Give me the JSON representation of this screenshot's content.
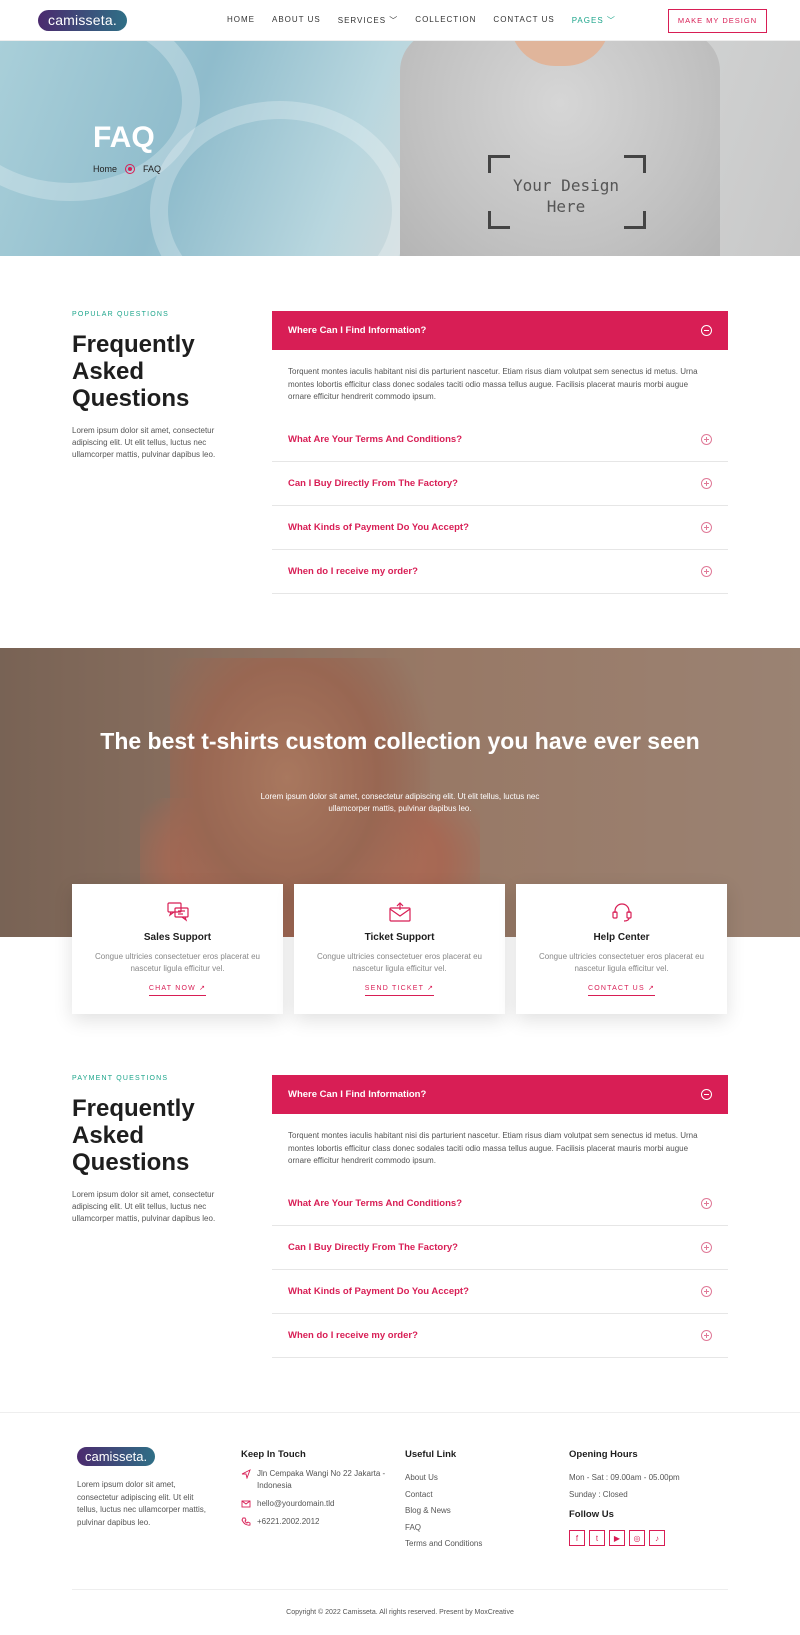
{
  "nav": {
    "logo": "camisseta.",
    "links": [
      "HOME",
      "ABOUT US",
      "SERVICES",
      "COLLECTION",
      "CONTACT US",
      "PAGES"
    ],
    "active": "PAGES",
    "cta": "MAKE MY DESIGN"
  },
  "hero": {
    "title": "FAQ",
    "breadcrumb_home": "Home",
    "breadcrumb_current": "FAQ",
    "shirt_text_line1": "Your Design",
    "shirt_text_line2": "Here"
  },
  "faq1": {
    "eyebrow": "POPULAR QUESTIONS",
    "heading": "Frequently Asked Questions",
    "description": "Lorem ipsum dolor sit amet, consectetur adipiscing elit. Ut elit tellus, luctus nec ullamcorper mattis, pulvinar dapibus leo.",
    "open_question": "Where Can I Find Information?",
    "open_answer": "Torquent montes iaculis habitant nisi dis parturient nascetur. Etiam risus diam volutpat sem senectus id metus. Urna montes lobortis efficitur class donec sodales taciti odio massa tellus augue. Facilisis placerat mauris morbi augue ornare efficitur hendrerit commodo ipsum.",
    "questions": [
      "What Are Your Terms And Conditions?",
      "Can I Buy Directly From The Factory?",
      "What Kinds of Payment Do You Accept?",
      "When do I receive my order?"
    ]
  },
  "banner": {
    "title": "The best t-shirts custom collection you have ever seen",
    "subtitle": "Lorem ipsum dolor sit amet, consectetur adipiscing elit. Ut elit tellus, luctus nec ullamcorper mattis, pulvinar dapibus leo."
  },
  "cards": [
    {
      "title": "Sales Support",
      "text": "Congue ultricies consectetuer eros placerat eu nascetur ligula efficitur vel.",
      "link": "CHAT NOW ↗",
      "icon": "chat-bubbles-icon"
    },
    {
      "title": "Ticket Support",
      "text": "Congue ultricies consectetuer eros placerat eu nascetur ligula efficitur vel.",
      "link": "SEND TICKET ↗",
      "icon": "envelope-icon"
    },
    {
      "title": "Help Center",
      "text": "Congue ultricies consectetuer eros placerat eu nascetur ligula efficitur vel.",
      "link": "CONTACT US ↗",
      "icon": "headset-icon"
    }
  ],
  "faq2": {
    "eyebrow": "PAYMENT QUESTIONS",
    "heading": "Frequently Asked Questions",
    "description": "Lorem ipsum dolor sit amet, consectetur adipiscing elit. Ut elit tellus, luctus nec ullamcorper mattis, pulvinar dapibus leo.",
    "open_question": "Where Can I Find Information?",
    "open_answer": "Torquent montes iaculis habitant nisi dis parturient nascetur. Etiam risus diam volutpat sem senectus id metus. Urna montes lobortis efficitur class donec sodales taciti odio massa tellus augue. Facilisis placerat mauris morbi augue ornare efficitur hendrerit commodo ipsum.",
    "questions": [
      "What Are Your Terms And Conditions?",
      "Can I Buy Directly From The Factory?",
      "What Kinds of Payment Do You Accept?",
      "When do I receive my order?"
    ]
  },
  "footer": {
    "logo": "camisseta.",
    "about": "Lorem ipsum dolor sit amet, consectetur adipiscing elit. Ut elit tellus, luctus nec ullamcorper mattis, pulvinar dapibus leo.",
    "keep_in_touch": "Keep In Touch",
    "address": "Jln Cempaka Wangi No 22 Jakarta - Indonesia",
    "email": "hello@yourdomain.tld",
    "phone": "+6221.2002.2012",
    "useful_link": "Useful Link",
    "links": [
      "About Us",
      "Contact",
      "Blog & News",
      "FAQ",
      "Terms and Conditions"
    ],
    "opening_hours": "Opening Hours",
    "hours_week": "Mon - Sat : 09.00am - 05.00pm",
    "hours_sunday": "Sunday : Closed",
    "follow_us": "Follow Us",
    "socials": [
      "f",
      "t",
      "▶",
      "◎",
      "♪"
    ],
    "copyright": "Copyright © 2022 Camisseta. All rights reserved. Present by MoxCreative"
  },
  "colors": {
    "accent": "#d81e55",
    "green": "#1da58b"
  }
}
